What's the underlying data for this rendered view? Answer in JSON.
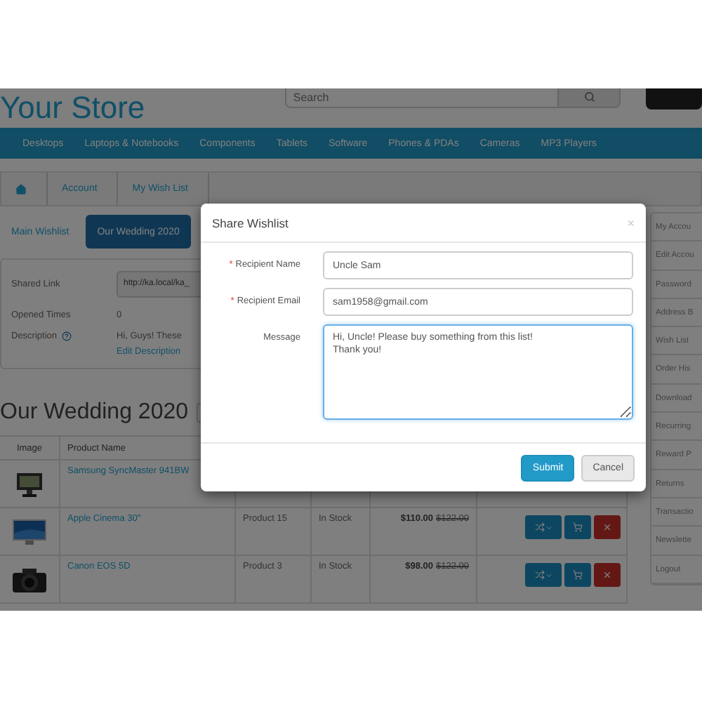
{
  "store": {
    "name": "Your Store",
    "search_placeholder": "Search"
  },
  "nav": [
    "Desktops",
    "Laptops & Notebooks",
    "Components",
    "Tablets",
    "Software",
    "Phones & PDAs",
    "Cameras",
    "MP3 Players"
  ],
  "breadcrumb": [
    {
      "kind": "home"
    },
    {
      "kind": "link",
      "label": "Account"
    },
    {
      "kind": "link",
      "label": "My Wish List"
    }
  ],
  "tabs": [
    {
      "label": "Main Wishlist",
      "selected": false
    },
    {
      "label": "Our Wedding 2020",
      "selected": true
    }
  ],
  "info": {
    "shared_link_label": "Shared Link",
    "shared_link_value": "http://ka.local/ka_",
    "opened_label": "Opened Times",
    "opened_value": "0",
    "description_label": "Description",
    "description_value": "Hi, Guys! These",
    "edit_link": "Edit Description"
  },
  "wishlist_title": "Our Wedding 2020",
  "table": {
    "columns": [
      "Image",
      "Product Name"
    ],
    "rows": [
      {
        "name": "Samsung SyncMaster 941BW"
      },
      {
        "name": "Apple Cinema 30\"",
        "model": "Product 15",
        "stock": "In Stock",
        "price": "$110.00",
        "old_price": "$122.00"
      },
      {
        "name": "Canon EOS 5D",
        "model": "Product 3",
        "stock": "In Stock",
        "price": "$98.00",
        "old_price": "$122.00"
      }
    ]
  },
  "sidebar": [
    "My Accou",
    "Edit Accou",
    "Password",
    "Address B",
    "Wish List",
    "Order His",
    "Download",
    "Recurring",
    "Reward P",
    "Returns",
    "Transactio",
    "Newslette",
    "Logout"
  ],
  "modal": {
    "title": "Share Wishlist",
    "close": "×",
    "required_mark": "*",
    "fields": [
      {
        "kind": "input",
        "label": "Recipient Name",
        "required": true,
        "value": "Uncle Sam"
      },
      {
        "kind": "input",
        "label": "Recipient Email",
        "required": true,
        "value": "sam1958@gmail.com"
      },
      {
        "kind": "textarea",
        "label": "Message",
        "required": false,
        "value": "Hi, Uncle! Please buy something from this list!\nThank you!"
      }
    ],
    "buttons": [
      {
        "kind": "primary",
        "label": "Submit"
      },
      {
        "kind": "default",
        "label": "Cancel"
      }
    ]
  }
}
